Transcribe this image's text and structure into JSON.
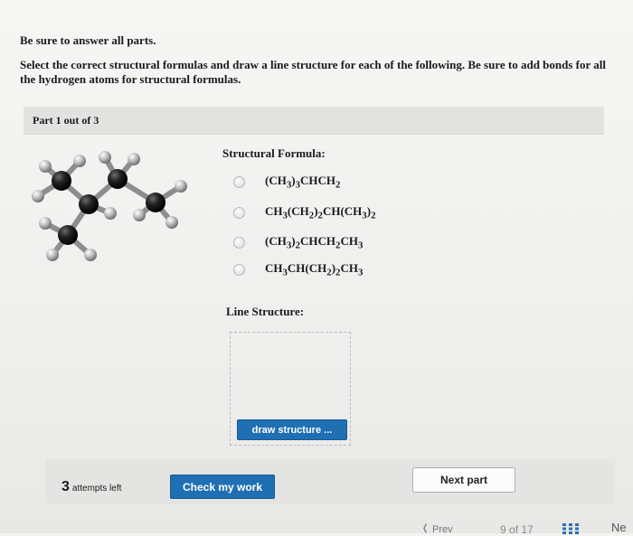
{
  "instructions": {
    "line1": "Be sure to answer all parts.",
    "line2": "Select the correct structural formulas and draw a line structure for each of the following. Be sure to add bonds for all the hydrogen atoms for structural formulas."
  },
  "part": {
    "label": "Part 1 out of 3"
  },
  "structural_formula": {
    "label": "Structural Formula:",
    "options": [
      {
        "html": "(CH<sub>3</sub>)<sub>3</sub>CHCH<sub>2</sub>"
      },
      {
        "html": "CH<sub>3</sub>(CH<sub>2</sub>)<sub>2</sub>CH(CH<sub>3</sub>)<sub>2</sub>"
      },
      {
        "html": "(CH<sub>3</sub>)<sub>2</sub>CHCH<sub>2</sub>CH<sub>3</sub>"
      },
      {
        "html": "CH<sub>3</sub>CH(CH<sub>2</sub>)<sub>2</sub>CH<sub>3</sub>"
      }
    ]
  },
  "line_structure": {
    "label": "Line Structure:",
    "draw_button": "draw structure ..."
  },
  "footer": {
    "attempts_number": "3",
    "attempts_text": "attempts left",
    "check_button": "Check my work",
    "next_part_button": "Next part"
  },
  "nav": {
    "prev": "Prev",
    "page_current": "9",
    "page_of": "of",
    "page_total": "17",
    "next": "Ne"
  },
  "colors": {
    "button_blue": "#1f6fb4",
    "carbon": "#1e1e1e",
    "hydrogen": "#9a9a9a"
  }
}
